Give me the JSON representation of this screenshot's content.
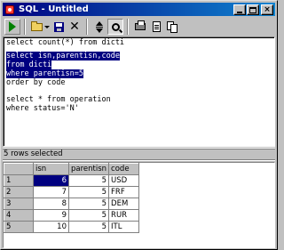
{
  "window": {
    "title": "SQL - Untitled",
    "title_buttons": {
      "minimize_icon": "minimize-icon",
      "maximize_icon": "maximize-icon",
      "close_label": "×"
    }
  },
  "toolbar": {
    "buttons": [
      {
        "name": "run-button",
        "icon": "play-icon",
        "color": "#008000"
      },
      {
        "name": "open-button",
        "icon": "folder-icon"
      },
      {
        "name": "save-button",
        "icon": "disk-icon"
      },
      {
        "name": "delete-button",
        "icon": "close-icon",
        "glyph": "✕"
      },
      {
        "name": "navigate-button",
        "icon": "up-down-icon"
      },
      {
        "name": "find-button",
        "icon": "search-icon",
        "pressed": true
      },
      {
        "name": "print-button",
        "icon": "printer-icon"
      },
      {
        "name": "page-button",
        "icon": "page-icon"
      },
      {
        "name": "copy-button",
        "icon": "copy-icon"
      }
    ]
  },
  "editor": {
    "lines": [
      "select count(*) from dicti",
      "",
      "select isn,parentisn,code",
      "from dicti",
      "where parentisn=5",
      "order by code",
      "",
      "select * from operation",
      "where status='N'"
    ],
    "selected_lines": [
      2,
      3,
      4
    ],
    "selection_color": "#000080"
  },
  "status": {
    "text": "5 rows selected"
  },
  "grid": {
    "columns": [
      "isn",
      "parentisn",
      "code"
    ],
    "rows": [
      {
        "row": "1",
        "isn": "6",
        "parentisn": "5",
        "code": "USD"
      },
      {
        "row": "2",
        "isn": "7",
        "parentisn": "5",
        "code": "FRF"
      },
      {
        "row": "3",
        "isn": "8",
        "parentisn": "5",
        "code": "DEM"
      },
      {
        "row": "4",
        "isn": "9",
        "parentisn": "5",
        "code": "RUR"
      },
      {
        "row": "5",
        "isn": "10",
        "parentisn": "5",
        "code": "ITL"
      }
    ],
    "selected_cell": {
      "row": 0,
      "column": "isn"
    }
  }
}
